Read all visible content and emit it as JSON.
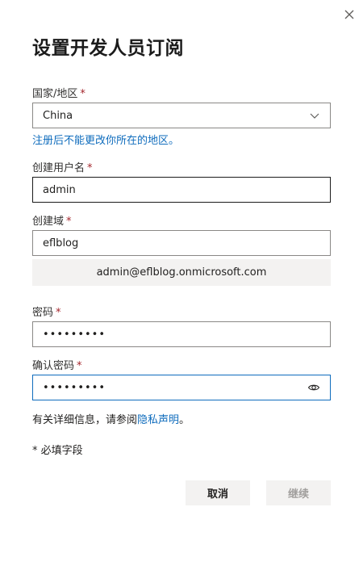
{
  "dialog": {
    "title": "设置开发人员订阅",
    "required_mark": "*"
  },
  "country": {
    "label": "国家/地区",
    "value": "China",
    "hint": "注册后不能更改你所在的地区。"
  },
  "username": {
    "label": "创建用户名",
    "value": "admin"
  },
  "domain": {
    "label": "创建域",
    "value": "eflblog",
    "preview": "admin@eflblog.onmicrosoft.com"
  },
  "password": {
    "label": "密码",
    "masked_value": "•••••••••"
  },
  "confirm_password": {
    "label": "确认密码",
    "masked_value": "•••••••••"
  },
  "privacy": {
    "text": "有关详细信息，请参阅",
    "link": "隐私声明",
    "suffix": "。"
  },
  "required_note": "* 必填字段",
  "buttons": {
    "cancel": "取消",
    "next": "继续"
  },
  "icons": {
    "close": "close-icon",
    "dropdown": "chevron-down-icon",
    "reveal": "eye-icon"
  }
}
